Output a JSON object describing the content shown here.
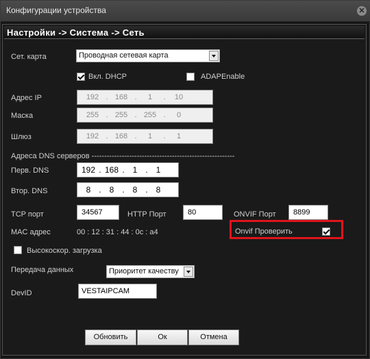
{
  "window": {
    "title": "Конфигурации устройства",
    "close_glyph": "✕"
  },
  "breadcrumb": "Настройки -> Система -> Сеть",
  "net_card": {
    "label": "Сет. карта",
    "value": "Проводная сетевая карта"
  },
  "dhcp": {
    "label": "Вкл. DHCP",
    "checked": true
  },
  "adap": {
    "label": "ADAPEnable",
    "checked": false
  },
  "ip": {
    "label": "Адрес IP",
    "octets": [
      "192",
      "168",
      "1",
      "10"
    ]
  },
  "mask": {
    "label": "Маска",
    "octets": [
      "255",
      "255",
      "255",
      "0"
    ]
  },
  "gateway": {
    "label": "Шлюз",
    "octets": [
      "192",
      "168",
      "1",
      "1"
    ]
  },
  "dns_header": "Адреса DNS серверов ---------------------------------------------------------",
  "dns1": {
    "label": "Перв. DNS",
    "octets": [
      "192",
      "168",
      "1",
      "1"
    ]
  },
  "dns2": {
    "label": "Втор. DNS",
    "octets": [
      "8",
      "8",
      "8",
      "8"
    ]
  },
  "tcp": {
    "label": "TCP порт",
    "value": "34567"
  },
  "http": {
    "label": "HTTP Порт",
    "value": "80"
  },
  "onvif_port": {
    "label": "ONVIF Порт",
    "value": "8899"
  },
  "mac": {
    "label": "MAC адрес",
    "value": "00 : 12 : 31 : 44 : 0c : a4"
  },
  "onvif_check": {
    "label": "Onvif Проверить",
    "checked": true
  },
  "highspeed": {
    "label": "Высокоскор. загрузка",
    "checked": false
  },
  "transfer": {
    "label": "Передача данных",
    "value": "Приоритет качеству"
  },
  "devid": {
    "label": "DevID",
    "value": "VESTAIPCAM"
  },
  "buttons": {
    "refresh": "Обновить",
    "ok": "Ок",
    "cancel": "Отмена"
  },
  "colors": {
    "highlight": "#e0141c",
    "background": "#1a1a1a"
  }
}
